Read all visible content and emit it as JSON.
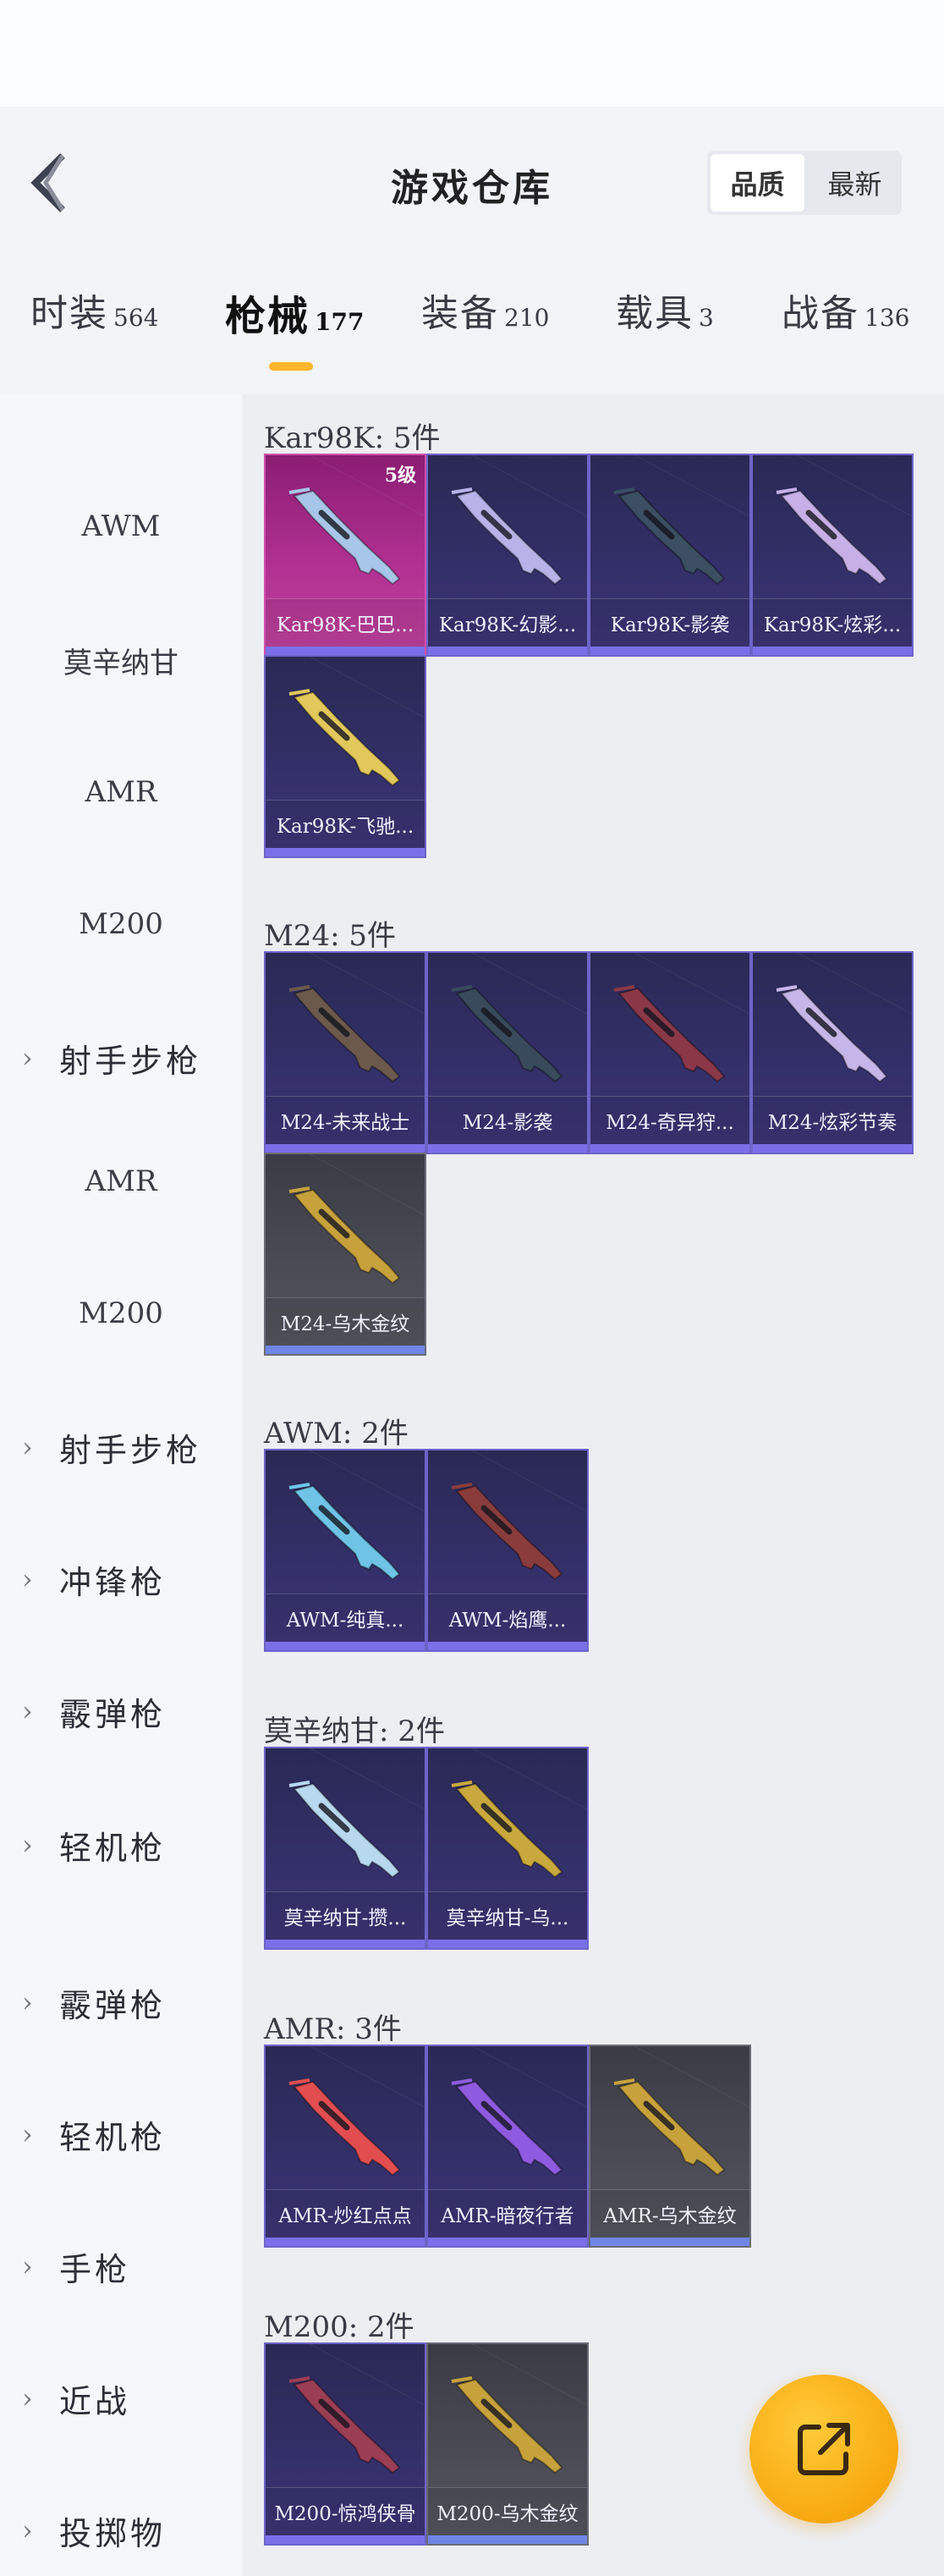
{
  "header": {
    "title": "游戏仓库",
    "sort_options": [
      "品质",
      "最新"
    ],
    "active_sort": "品质"
  },
  "tabs": [
    {
      "label": "时装",
      "count": "564"
    },
    {
      "label": "枪械",
      "count": "177"
    },
    {
      "label": "装备",
      "count": "210"
    },
    {
      "label": "载具",
      "count": "3"
    },
    {
      "label": "战备",
      "count": "136"
    }
  ],
  "active_tab": "枪械",
  "sidebar": {
    "items": [
      {
        "label": "AWM",
        "kind": "sub"
      },
      {
        "label": "莫辛纳甘",
        "kind": "sub"
      },
      {
        "label": "AMR",
        "kind": "sub"
      },
      {
        "label": "M200",
        "kind": "sub"
      },
      {
        "label": "射手步枪",
        "kind": "cat"
      },
      {
        "label": "AMR",
        "kind": "sub"
      },
      {
        "label": "M200",
        "kind": "sub"
      },
      {
        "label": "射手步枪",
        "kind": "cat"
      },
      {
        "label": "冲锋枪",
        "kind": "cat"
      },
      {
        "label": "霰弹枪",
        "kind": "cat"
      },
      {
        "label": "轻机枪",
        "kind": "cat"
      },
      {
        "label": "霰弹枪",
        "kind": "cat"
      },
      {
        "label": "轻机枪",
        "kind": "cat"
      },
      {
        "label": "手枪",
        "kind": "cat"
      },
      {
        "label": "近战",
        "kind": "cat"
      },
      {
        "label": "投掷物",
        "kind": "cat"
      }
    ]
  },
  "sections": [
    {
      "title": "Kar98K: 5件",
      "items": [
        {
          "name": "Kar98K-巴巴...",
          "quality": "pink",
          "level": "5级",
          "gun": "#a8c6e8"
        },
        {
          "name": "Kar98K-幻影...",
          "quality": "purple",
          "gun": "#b7b3e8"
        },
        {
          "name": "Kar98K-影袭",
          "quality": "purple",
          "gun": "#3b4e62"
        },
        {
          "name": "Kar98K-炫彩...",
          "quality": "purple",
          "gun": "#c6b0e6"
        },
        {
          "name": "Kar98K-飞驰...",
          "quality": "purple",
          "gun": "#e2c75a"
        }
      ]
    },
    {
      "title": "M24: 5件",
      "items": [
        {
          "name": "M24-未来战士",
          "quality": "purple",
          "gun": "#6b5a4c"
        },
        {
          "name": "M24-影袭",
          "quality": "purple",
          "gun": "#394a5c"
        },
        {
          "name": "M24-奇异狩...",
          "quality": "purple",
          "gun": "#8a3848"
        },
        {
          "name": "M24-炫彩节奏",
          "quality": "purple",
          "gun": "#c6b6e8"
        },
        {
          "name": "M24-乌木金纹",
          "quality": "gray",
          "gun": "#c7a23c"
        }
      ]
    },
    {
      "title": "AWM: 2件",
      "items": [
        {
          "name": "AWM-纯真...",
          "quality": "purple",
          "gun": "#6fc4e6"
        },
        {
          "name": "AWM-焰鹰...",
          "quality": "purple",
          "gun": "#8a3c3c"
        }
      ]
    },
    {
      "title": "莫辛纳甘: 2件",
      "items": [
        {
          "name": "莫辛纳甘-攒...",
          "quality": "purple",
          "gun": "#b8d8f0"
        },
        {
          "name": "莫辛纳甘-乌...",
          "quality": "purple",
          "gun": "#c9a83e"
        }
      ]
    },
    {
      "title": "AMR: 3件",
      "items": [
        {
          "name": "AMR-炒红点点",
          "quality": "purple",
          "gun": "#e24d50"
        },
        {
          "name": "AMR-暗夜行者",
          "quality": "purple",
          "gun": "#8e5be0"
        },
        {
          "name": "AMR-乌木金纹",
          "quality": "gray",
          "gun": "#c7a23c"
        }
      ]
    },
    {
      "title": "M200: 2件",
      "items": [
        {
          "name": "M200-惊鸿侠骨",
          "quality": "purple",
          "gun": "#9b3d55"
        },
        {
          "name": "M200-乌木金纹",
          "quality": "gray",
          "gun": "#c7a23c"
        }
      ]
    }
  ],
  "colors": {
    "accent": "#ffb52a",
    "fab": "#f8a90f"
  },
  "icons": {
    "back": "chevron-left-icon",
    "fab": "share-export-icon",
    "expand": "chevron-right-icon"
  }
}
